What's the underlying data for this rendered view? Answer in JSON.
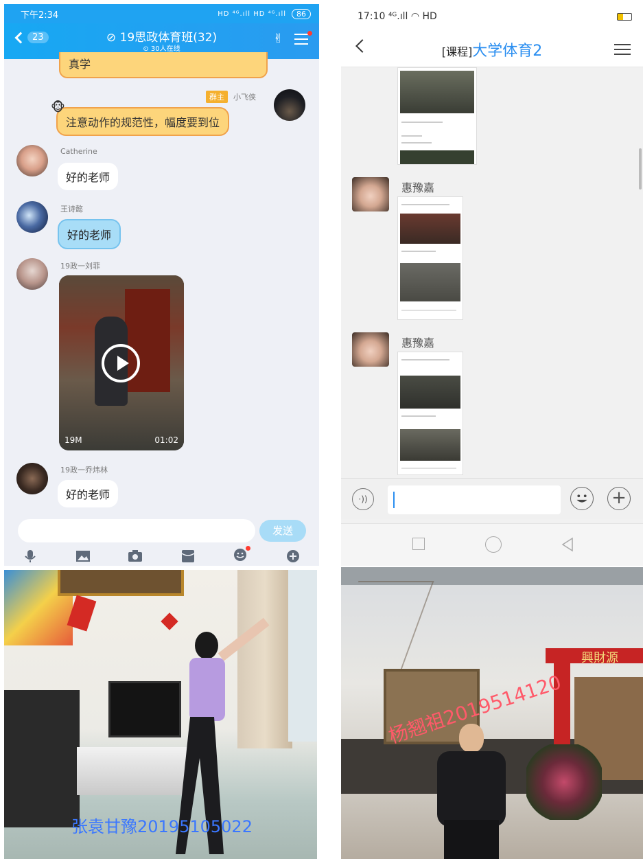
{
  "qq_chat": {
    "status": {
      "time": "下午2:34",
      "signal": "HD ⁴ᴳ.ıll HD ⁴ᴳ.ıll",
      "battery": "86"
    },
    "nav": {
      "unread_count": "23",
      "title": "19思政体育班(32)",
      "online": "30人在线"
    },
    "messages": [
      {
        "text": "真学"
      },
      {
        "tag": "群主",
        "sender": "小飞侠",
        "text": "注意动作的规范性，幅度要到位"
      },
      {
        "sender": "Catherine",
        "text": "好的老师"
      },
      {
        "sender": "王诗懿",
        "text": "好的老师"
      },
      {
        "sender": "19政一刘菲",
        "video_size": "19M",
        "video_duration": "01:02"
      },
      {
        "sender": "19政一乔炜林",
        "text": "好的老师"
      }
    ],
    "input": {
      "send_label": "发送"
    }
  },
  "course_chat": {
    "status": {
      "time": "17:10",
      "network": "HD"
    },
    "nav": {
      "prefix": "[课程]",
      "title": "大学体育2"
    },
    "messages": [
      {
        "sender": "惠豫嘉"
      },
      {
        "sender": "惠豫嘉"
      }
    ],
    "voice_icon": "·))"
  },
  "photos": {
    "watermark_1": "张袁甘豫20195105022",
    "watermark_2": "杨翘祖2019514120",
    "sign_2": "興財源"
  }
}
